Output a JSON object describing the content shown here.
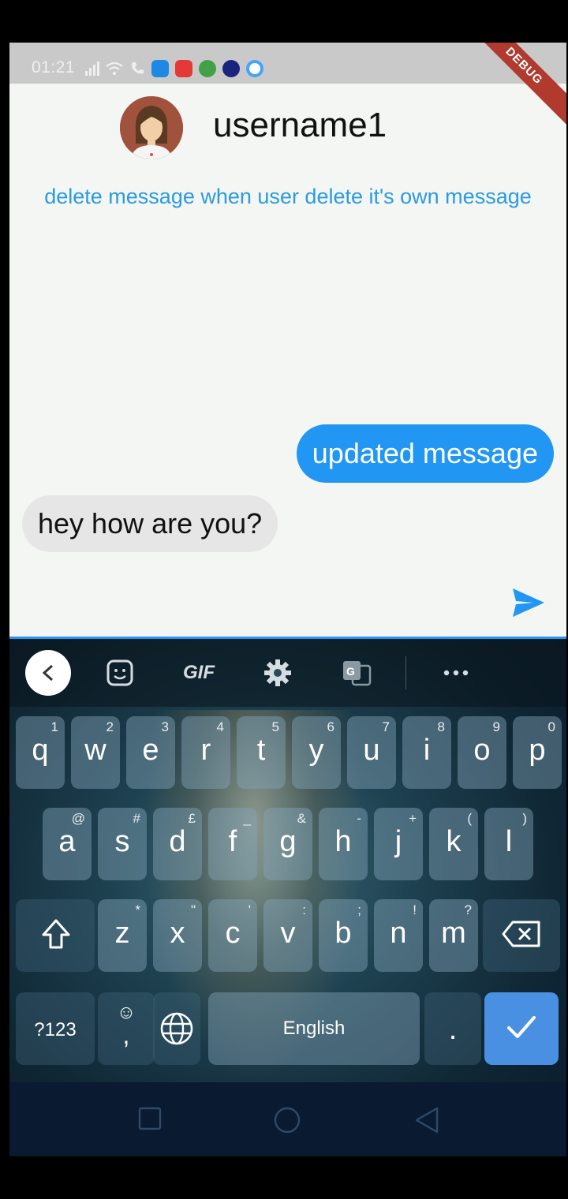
{
  "status_bar": {
    "time": "01:21",
    "debug_label": "DEBUG"
  },
  "chat": {
    "username": "username1",
    "notice": "delete message when user delete it's own message",
    "messages": [
      {
        "text": "updated message",
        "from": "me"
      },
      {
        "text": "hey how are you?",
        "from": "other"
      }
    ]
  },
  "keyboard": {
    "toolbar": {
      "gif_label": "GIF"
    },
    "rows": [
      [
        {
          "k": "q",
          "s": "1"
        },
        {
          "k": "w",
          "s": "2"
        },
        {
          "k": "e",
          "s": "3"
        },
        {
          "k": "r",
          "s": "4"
        },
        {
          "k": "t",
          "s": "5"
        },
        {
          "k": "y",
          "s": "6"
        },
        {
          "k": "u",
          "s": "7"
        },
        {
          "k": "i",
          "s": "8"
        },
        {
          "k": "o",
          "s": "9"
        },
        {
          "k": "p",
          "s": "0"
        }
      ],
      [
        {
          "k": "a",
          "s": "@"
        },
        {
          "k": "s",
          "s": "#"
        },
        {
          "k": "d",
          "s": "£"
        },
        {
          "k": "f",
          "s": "_"
        },
        {
          "k": "g",
          "s": "&"
        },
        {
          "k": "h",
          "s": "-"
        },
        {
          "k": "j",
          "s": "+"
        },
        {
          "k": "k",
          "s": "("
        },
        {
          "k": "l",
          "s": ")"
        }
      ],
      [
        {
          "k": "z",
          "s": "*"
        },
        {
          "k": "x",
          "s": "\""
        },
        {
          "k": "c",
          "s": "'"
        },
        {
          "k": "v",
          "s": ":"
        },
        {
          "k": "b",
          "s": ";"
        },
        {
          "k": "n",
          "s": "!"
        },
        {
          "k": "m",
          "s": "?"
        }
      ]
    ],
    "symbols_label": "?123",
    "comma_label": ",",
    "emoji_label": "☺",
    "space_label": "English",
    "period_label": "."
  },
  "colors": {
    "accent": "#2196f3",
    "notice": "#2a9be0",
    "received_bubble": "#e6e6e6",
    "debug_ribbon": "#b03a2e"
  }
}
